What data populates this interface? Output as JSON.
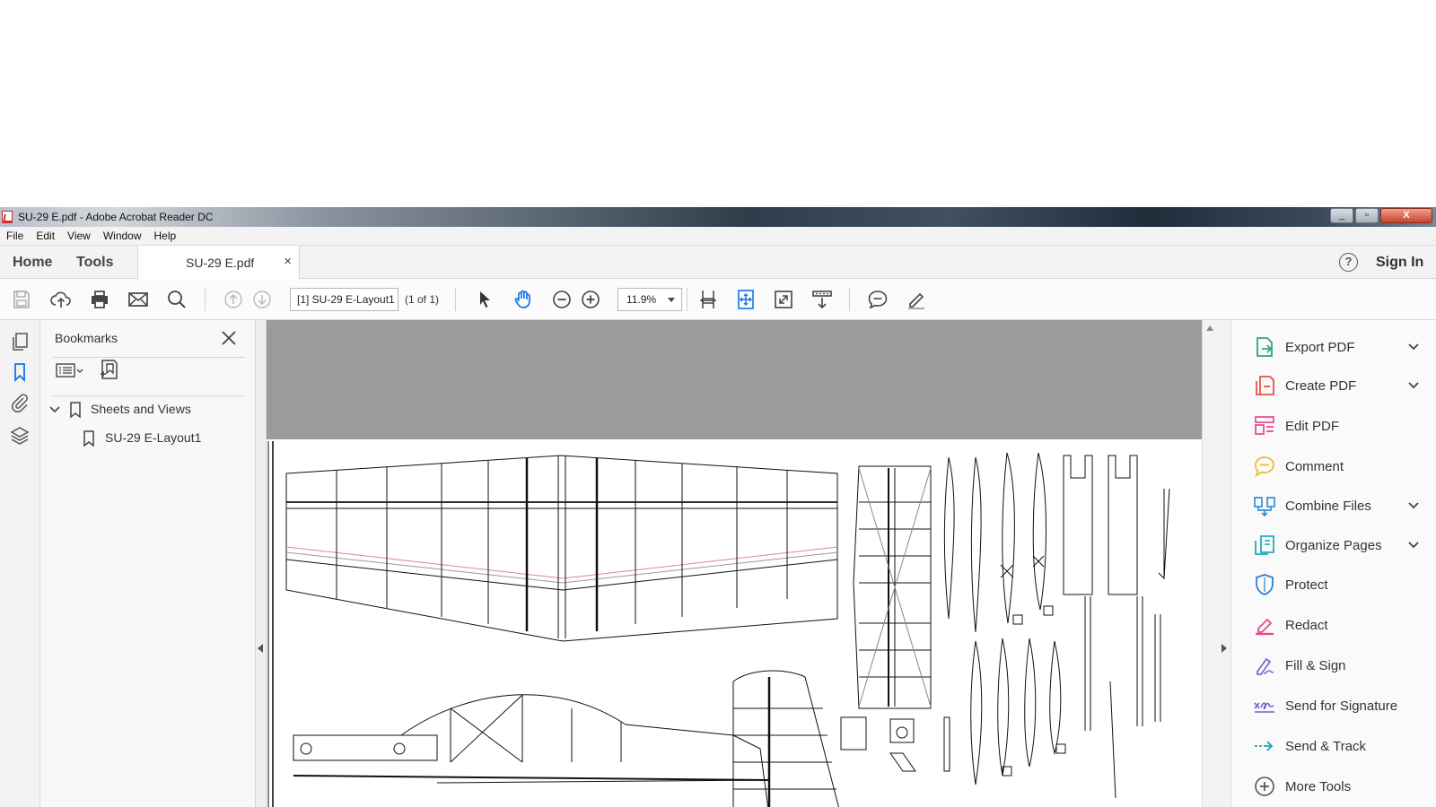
{
  "window": {
    "title": "SU-29 E.pdf - Adobe Acrobat Reader DC",
    "controls": {
      "minimize": "_",
      "restore": "▫",
      "close": "X"
    }
  },
  "menubar": {
    "items": [
      "File",
      "Edit",
      "View",
      "Window",
      "Help"
    ]
  },
  "tabs": {
    "home": "Home",
    "tools": "Tools",
    "document": "SU-29 E.pdf",
    "close_glyph": "×",
    "help_glyph": "?",
    "sign_in": "Sign In"
  },
  "toolbar": {
    "page_field_value": "[1] SU-29 E-Layout1",
    "page_count": "(1 of 1)",
    "zoom_value": "11.9%",
    "icons": [
      "save-icon",
      "upload-icon",
      "print-icon",
      "email-icon",
      "search-icon",
      "previous-page-icon",
      "next-page-icon",
      "select-cursor-icon",
      "hand-tool-icon",
      "zoom-out-icon",
      "zoom-in-icon",
      "fit-width-icon",
      "fit-page-icon",
      "full-screen-icon",
      "scroll-mode-icon",
      "comment-icon",
      "highlight-pen-icon"
    ]
  },
  "left_rail": {
    "icons": [
      "page-thumbnails-icon",
      "bookmark-icon",
      "attachment-icon",
      "layers-icon"
    ]
  },
  "bookmarks": {
    "title": "Bookmarks",
    "items": [
      {
        "label": "Sheets and Views",
        "expanded": true,
        "level": 0
      },
      {
        "label": "SU-29 E-Layout1",
        "level": 1
      }
    ]
  },
  "tools_panel": {
    "items": [
      {
        "label": "Export PDF",
        "icon": "export-pdf-icon",
        "color": "#2fa581",
        "has_dropdown": true
      },
      {
        "label": "Create PDF",
        "icon": "create-pdf-icon",
        "color": "#e5534b",
        "has_dropdown": true
      },
      {
        "label": "Edit PDF",
        "icon": "edit-pdf-icon",
        "color": "#e8488e",
        "has_dropdown": false
      },
      {
        "label": "Comment",
        "icon": "comment-icon",
        "color": "#f5b82e",
        "has_dropdown": false
      },
      {
        "label": "Combine Files",
        "icon": "combine-files-icon",
        "color": "#2e8fd6",
        "has_dropdown": true
      },
      {
        "label": "Organize Pages",
        "icon": "organize-pages-icon",
        "color": "#19a9b8",
        "has_dropdown": true
      },
      {
        "label": "Protect",
        "icon": "protect-icon",
        "color": "#2e7fd0",
        "has_dropdown": false
      },
      {
        "label": "Redact",
        "icon": "redact-icon",
        "color": "#e8488e",
        "has_dropdown": false
      },
      {
        "label": "Fill & Sign",
        "icon": "fill-sign-icon",
        "color": "#7b6bd6",
        "has_dropdown": false
      },
      {
        "label": "Send for Signature",
        "icon": "send-signature-icon",
        "color": "#6b63cf",
        "has_dropdown": false
      },
      {
        "label": "Send & Track",
        "icon": "send-track-icon",
        "color": "#1aa6b8",
        "has_dropdown": false
      },
      {
        "label": "More Tools",
        "icon": "more-tools-icon",
        "color": "#555555",
        "has_dropdown": false
      }
    ]
  }
}
